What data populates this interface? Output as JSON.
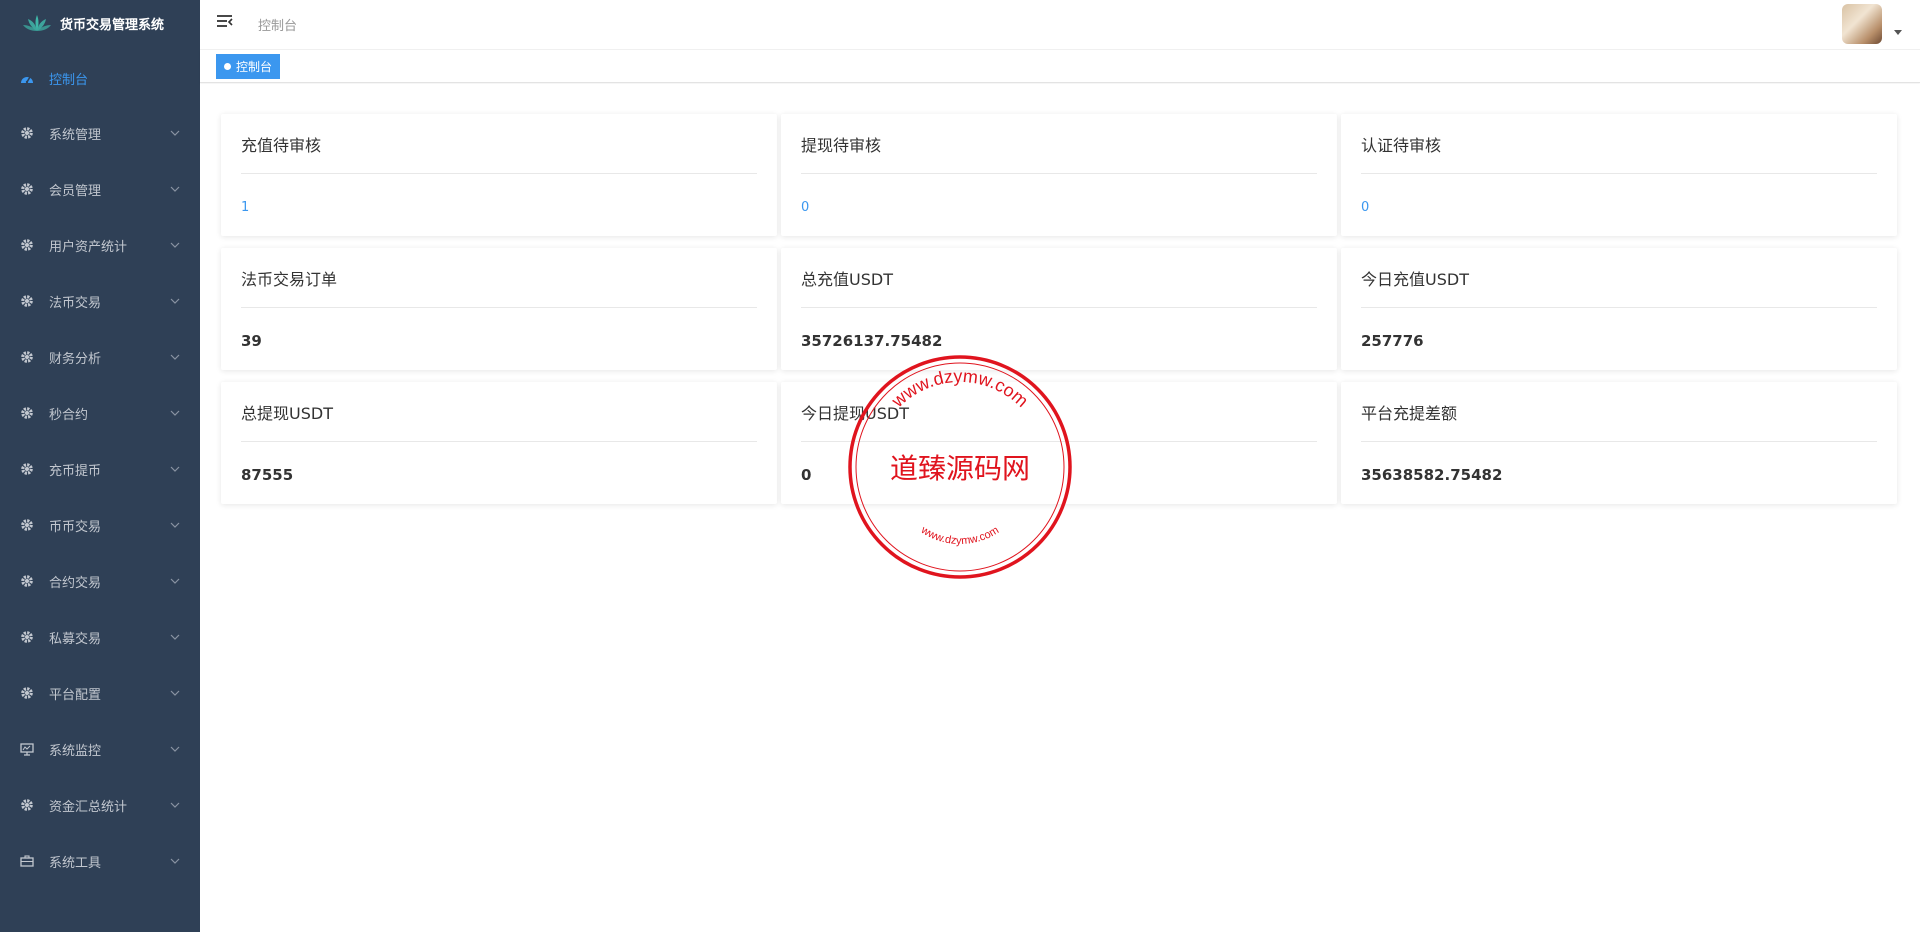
{
  "brand": {
    "title": "货币交易管理系统"
  },
  "sidebar": {
    "items": [
      {
        "label": "控制台",
        "icon": "dashboard-icon",
        "active": true
      },
      {
        "label": "系统管理",
        "icon": "gear-icon"
      },
      {
        "label": "会员管理",
        "icon": "gear-icon"
      },
      {
        "label": "用户资产统计",
        "icon": "gear-icon"
      },
      {
        "label": "法币交易",
        "icon": "gear-icon"
      },
      {
        "label": "财务分析",
        "icon": "gear-icon"
      },
      {
        "label": "秒合约",
        "icon": "gear-icon"
      },
      {
        "label": "充币提币",
        "icon": "gear-icon"
      },
      {
        "label": "币币交易",
        "icon": "gear-icon"
      },
      {
        "label": "合约交易",
        "icon": "gear-icon"
      },
      {
        "label": "私募交易",
        "icon": "gear-icon"
      },
      {
        "label": "平台配置",
        "icon": "gear-icon"
      },
      {
        "label": "系统监控",
        "icon": "monitor-icon"
      },
      {
        "label": "资金汇总统计",
        "icon": "gear-icon"
      },
      {
        "label": "系统工具",
        "icon": "toolbox-icon"
      }
    ]
  },
  "topbar": {
    "title": "控制台"
  },
  "tabs": [
    {
      "label": "控制台"
    }
  ],
  "cards": [
    {
      "title": "充值待审核",
      "value": "1"
    },
    {
      "title": "提现待审核",
      "value": "0"
    },
    {
      "title": "认证待审核",
      "value": "0"
    },
    {
      "title": "法币交易订单",
      "value": "39"
    },
    {
      "title": "总充值USDT",
      "value": "35726137.75482"
    },
    {
      "title": "今日充值USDT",
      "value": "257776"
    },
    {
      "title": "总提现USDT",
      "value": "87555"
    },
    {
      "title": "今日提现USDT",
      "value": "0"
    },
    {
      "title": "平台充提差额",
      "value": "35638582.75482"
    }
  ],
  "watermark": {
    "center_text": "道臻源码网",
    "top_arc": "www.dzymw.com",
    "bottom_arc": "www.dzymw.com",
    "color": "#e0141e"
  },
  "colors": {
    "sidebar_bg": "#2f4056",
    "accent": "#3b97ef"
  }
}
